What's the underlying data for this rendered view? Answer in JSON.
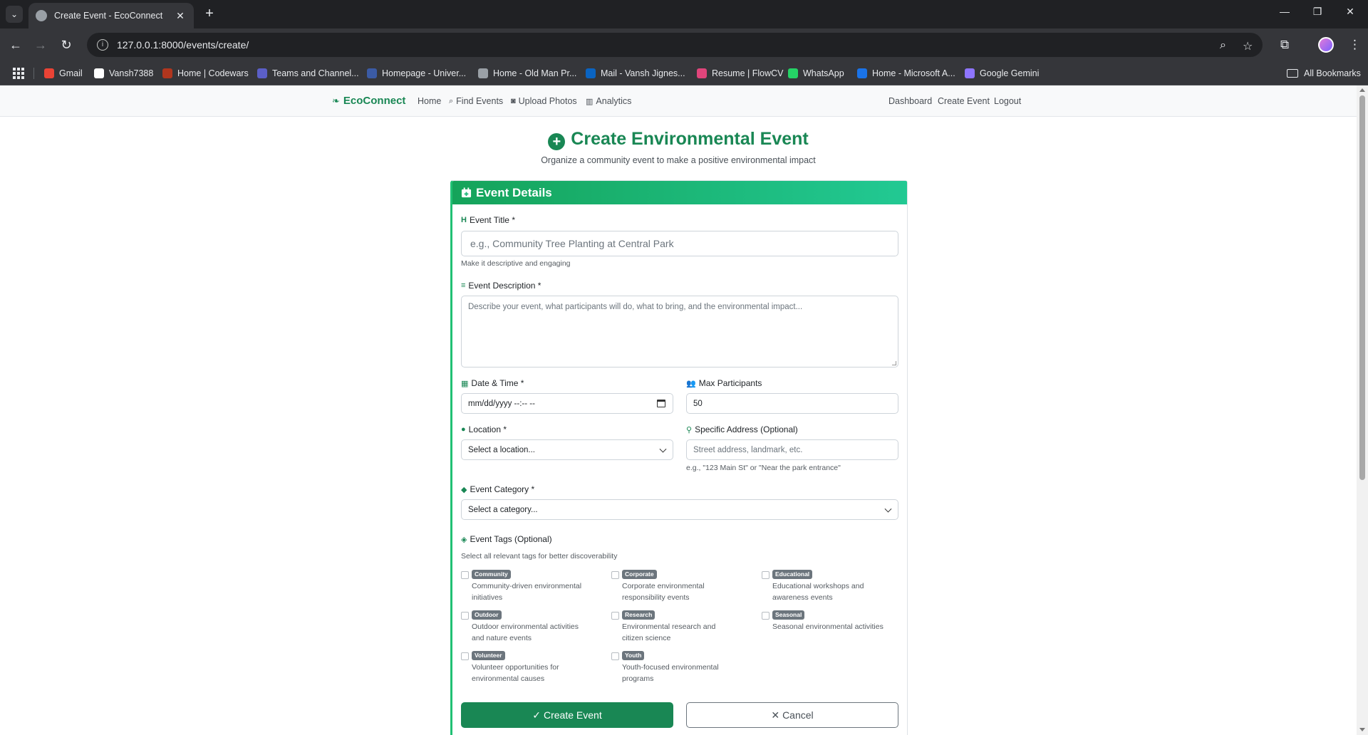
{
  "browser": {
    "tab_title": "Create Event - EcoConnect",
    "url": "127.0.0.1:8000/events/create/",
    "bookmarks": [
      {
        "label": "Gmail",
        "color": "#ea4335",
        "icon": "gmail-icon"
      },
      {
        "label": "Vansh7388",
        "color": "#ffffff",
        "icon": "github-icon"
      },
      {
        "label": "Home | Codewars",
        "color": "#b1361e",
        "icon": "codewars-icon"
      },
      {
        "label": "Teams and Channel...",
        "color": "#5b5fc7",
        "icon": "teams-icon"
      },
      {
        "label": "Homepage - Univer...",
        "color": "#3b5ba5",
        "icon": "university-icon"
      },
      {
        "label": "Home - Old Man Pr...",
        "color": "#9aa0a6",
        "icon": "globe-icon"
      },
      {
        "label": "Mail - Vansh Jignes...",
        "color": "#0a64c2",
        "icon": "outlook-icon"
      },
      {
        "label": "Resume | FlowCV",
        "color": "#e0457b",
        "icon": "flowcv-icon"
      },
      {
        "label": "WhatsApp",
        "color": "#25d366",
        "icon": "whatsapp-icon"
      },
      {
        "label": "Home - Microsoft A...",
        "color": "#1a73e8",
        "icon": "azure-icon"
      },
      {
        "label": "Google Gemini",
        "color": "#8e75ff",
        "icon": "gemini-icon"
      }
    ],
    "all_bookmarks": "All Bookmarks"
  },
  "nav": {
    "brand": "EcoConnect",
    "links": {
      "home": "Home",
      "find_events": "Find Events",
      "upload_photos": "Upload Photos",
      "analytics": "Analytics",
      "dashboard": "Dashboard",
      "create_event": "Create Event",
      "logout": "Logout"
    }
  },
  "page": {
    "title": "Create Environmental Event",
    "subtitle": "Organize a community event to make a positive environmental impact"
  },
  "form": {
    "header": "Event Details",
    "title_label": "Event Title *",
    "title_placeholder": "e.g., Community Tree Planting at Central Park",
    "title_help": "Make it descriptive and engaging",
    "description_label": "Event Description *",
    "description_placeholder": "Describe your event, what participants will do, what to bring, and the environmental impact...",
    "datetime_label": "Date & Time *",
    "datetime_value": "mm/dd/yyyy --:-- --",
    "max_label": "Max Participants",
    "max_value": "50",
    "location_label": "Location *",
    "location_value": "Select a location...",
    "address_label": "Specific Address (Optional)",
    "address_placeholder": "Street address, landmark, etc.",
    "address_help": "e.g., \"123 Main St\" or \"Near the park entrance\"",
    "category_label": "Event Category *",
    "category_value": "Select a category...",
    "tags_label": "Event Tags (Optional)",
    "tags_help": "Select all relevant tags for better discoverability",
    "tags": [
      {
        "name": "Community",
        "desc": "Community-driven environmental initiatives"
      },
      {
        "name": "Corporate",
        "desc": "Corporate environmental responsibility events"
      },
      {
        "name": "Educational",
        "desc": "Educational workshops and awareness events"
      },
      {
        "name": "Outdoor",
        "desc": "Outdoor environmental activities and nature events"
      },
      {
        "name": "Research",
        "desc": "Environmental research and citizen science"
      },
      {
        "name": "Seasonal",
        "desc": "Seasonal environmental activities"
      },
      {
        "name": "Volunteer",
        "desc": "Volunteer opportunities for environmental causes"
      },
      {
        "name": "Youth",
        "desc": "Youth-focused environmental programs"
      }
    ],
    "submit_label": "Create Event",
    "cancel_label": "Cancel"
  },
  "colors": {
    "accent": "#198754",
    "header_gradient_start": "#15a35a",
    "header_gradient_end": "#22c993",
    "badge": "#6c757d"
  }
}
